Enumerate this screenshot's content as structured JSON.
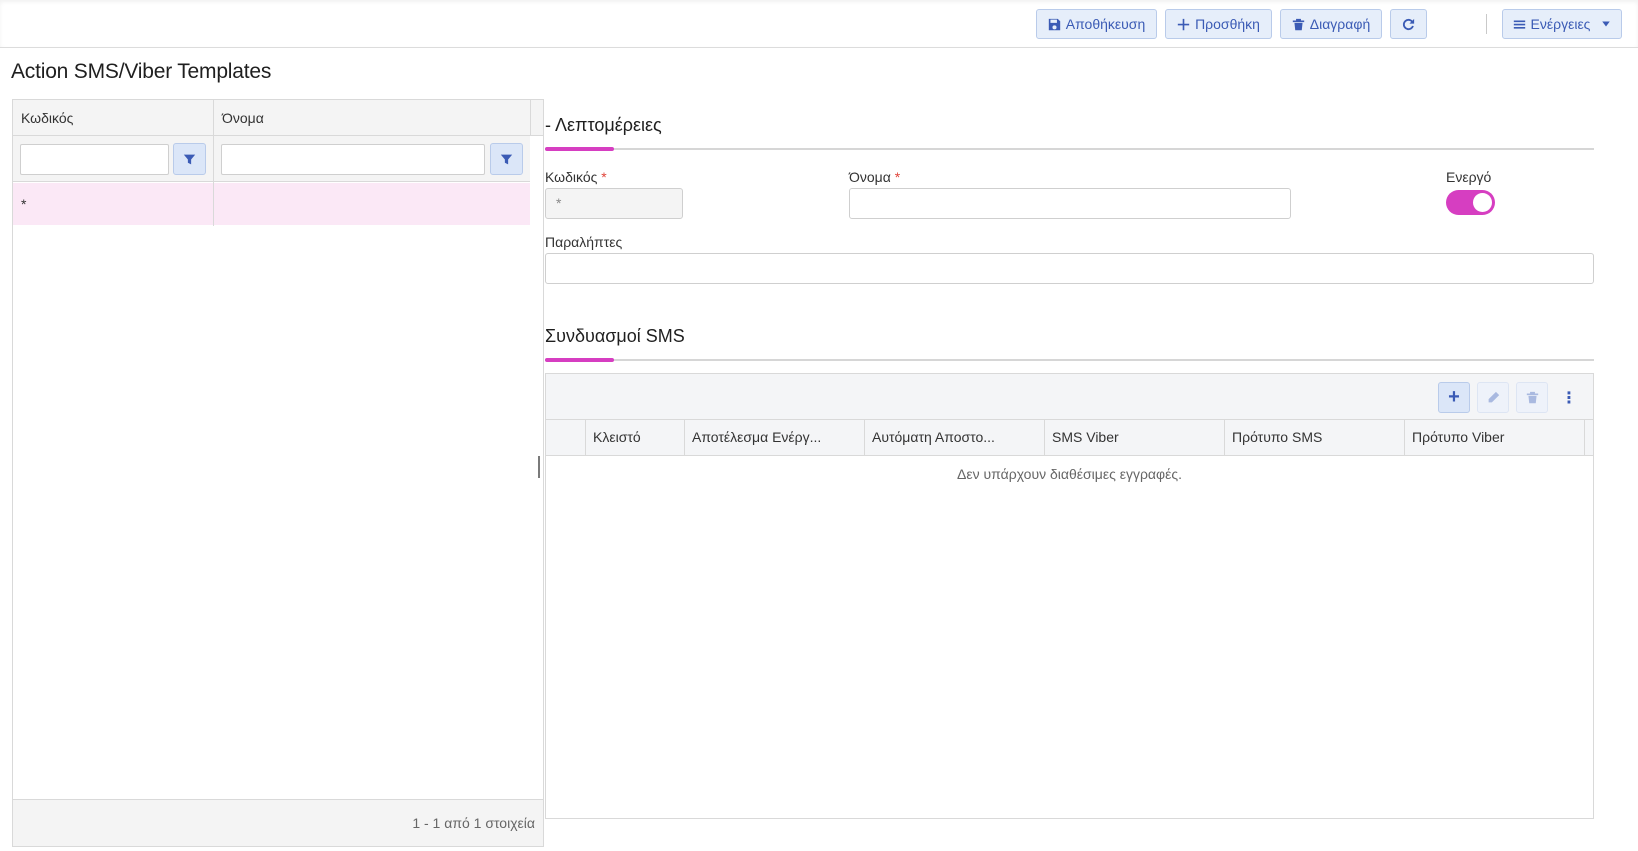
{
  "toolbar": {
    "save_label": "Αποθήκευση",
    "add_label": "Προσθήκη",
    "delete_label": "Διαγραφή",
    "actions_label": "Ενέργειες"
  },
  "page": {
    "title": "Action SMS/Viber Templates"
  },
  "list_grid": {
    "columns": [
      "Κωδικός",
      "Όνομα"
    ],
    "rows": [
      {
        "code": "*",
        "name": ""
      }
    ],
    "pager": "1 - 1 από 1 στοιχεία"
  },
  "details": {
    "section_title": "- Λεπτομέρειες",
    "code_label": "Κωδικός",
    "code_value": "*",
    "name_label": "Όνομα",
    "name_value": "",
    "required_mark": "*",
    "active_label": "Ενεργό",
    "active": true,
    "recipients_label": "Παραλήπτες",
    "recipients_value": ""
  },
  "sms_section": {
    "title": "Συνδυασμοί SMS",
    "columns": [
      "Κλειστό",
      "Αποτέλεσμα Ενέργ...",
      "Αυτόματη Αποστο...",
      "SMS Viber",
      "Πρότυπο SMS",
      "Πρότυπο Viber"
    ],
    "empty_text": "Δεν υπάρχουν διαθέσιμες εγγραφές.",
    "add_symbol": "+",
    "more_symbol": "⋮"
  },
  "colors": {
    "accent": "#d63ec1",
    "primary": "#3b5bb5",
    "selected_row": "#fbe8f6"
  },
  "icons": [
    "save-icon",
    "plus-icon",
    "trash-icon",
    "refresh-icon",
    "menu-icon",
    "caret-down-icon",
    "filter-icon",
    "pencil-icon",
    "more-vertical-icon"
  ]
}
